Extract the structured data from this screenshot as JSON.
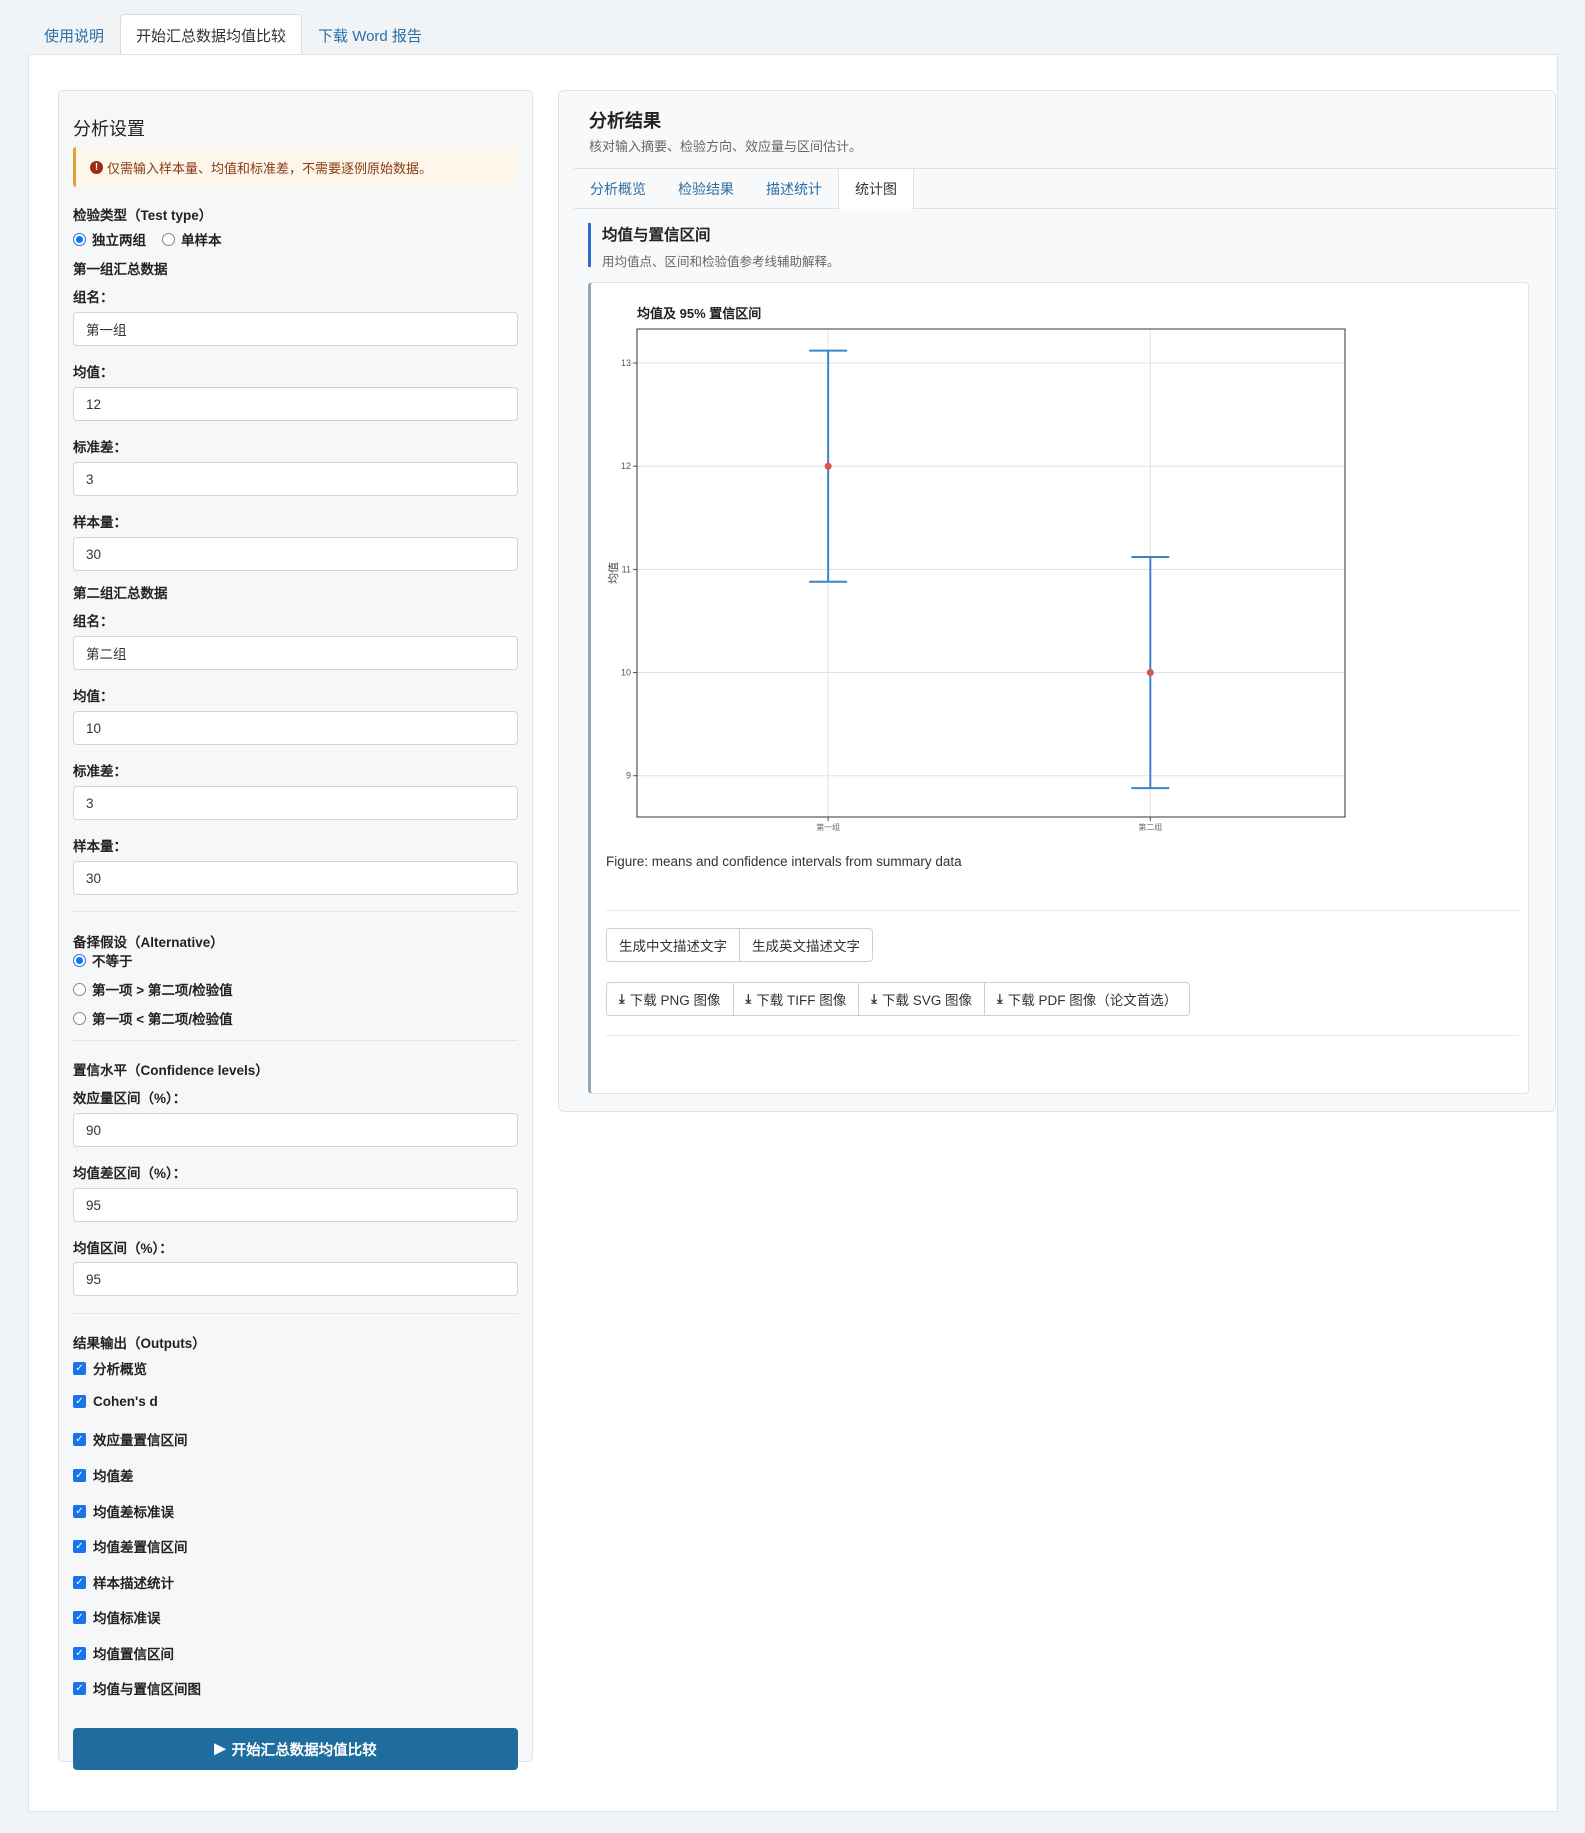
{
  "top_tabs": [
    "使用说明",
    "开始汇总数据均值比较",
    "下载 Word 报告"
  ],
  "settings": {
    "title": "分析设置",
    "notice": "仅需输入样本量、均值和标准差，不需要逐例原始数据。",
    "test_type_label": "检验类型（Test type）",
    "test_types": [
      "独立两组",
      "单样本"
    ],
    "test_type_selected": "独立两组",
    "group1_heading": "第一组汇总数据",
    "group2_heading": "第二组汇总数据",
    "labels": {
      "name": "组名：",
      "mean": "均值：",
      "sd": "标准差：",
      "n": "样本量："
    },
    "group1": {
      "name": "第一组",
      "mean": "12",
      "sd": "3",
      "n": "30"
    },
    "group2": {
      "name": "第二组",
      "mean": "10",
      "sd": "3",
      "n": "30"
    },
    "alternative_label": "备择假设（Alternative）",
    "alternatives": [
      "不等于",
      "第一项 > 第二项/检验值",
      "第一项 < 第二项/检验值"
    ],
    "alternative_selected": "不等于",
    "conf_label": "置信水平（Confidence levels）",
    "conf_es_label": "效应量区间（%）：",
    "conf_es": "90",
    "conf_md_label": "均值差区间（%）：",
    "conf_md": "95",
    "conf_mean_label": "均值区间（%）：",
    "conf_mean": "95",
    "outputs_label": "结果输出（Outputs）",
    "outputs": [
      "分析概览",
      "Cohen's d",
      "效应量置信区间",
      "均值差",
      "均值差标准误",
      "均值差置信区间",
      "样本描述统计",
      "均值标准误",
      "均值置信区间",
      "均值与置信区间图"
    ],
    "run_label": "开始汇总数据均值比较"
  },
  "results": {
    "title": "分析结果",
    "subtitle": "核对输入摘要、检验方向、效应量与区间估计。",
    "tabs": [
      "分析概览",
      "检验结果",
      "描述统计",
      "统计图"
    ],
    "active_tab": "统计图",
    "section_title": "均值与置信区间",
    "section_desc": "用均值点、区间和检验值参考线辅助解释。",
    "caption": "Figure: means and confidence intervals from summary data",
    "text_buttons": [
      "生成中文描述文字",
      "生成英文描述文字"
    ],
    "download_buttons": [
      "下载 PNG 图像",
      "下载 TIFF 图像",
      "下载 SVG 图像",
      "下载 PDF 图像（论文首选）"
    ]
  },
  "chart_data": {
    "type": "scatter",
    "title": "均值及 95% 置信区间",
    "xlabel": "",
    "ylabel": "均值",
    "categories": [
      "第一组",
      "第二组"
    ],
    "means": [
      12,
      10
    ],
    "lower": [
      10.88,
      8.88
    ],
    "upper": [
      13.12,
      11.12
    ],
    "ylim": [
      8.6,
      13.33
    ],
    "yticks": [
      9,
      10,
      11,
      12,
      13
    ],
    "grid": true,
    "colors": {
      "interval": "#3d86c6",
      "point": "#d9534f"
    }
  }
}
